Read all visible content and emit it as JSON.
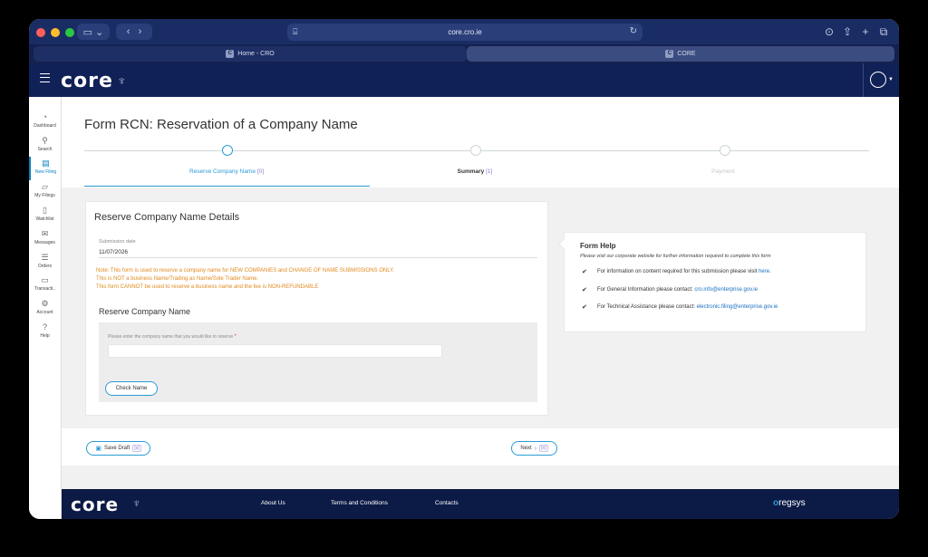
{
  "browser": {
    "url": "core.cro.ie",
    "tabs": [
      {
        "label": "Home - CRO",
        "favicon": "C"
      },
      {
        "label": "CORE",
        "favicon": "C"
      }
    ]
  },
  "app": {
    "logo": "core",
    "sidebar": [
      {
        "label": "Dashboard",
        "icon": "gauge-icon"
      },
      {
        "label": "Search",
        "icon": "search-icon"
      },
      {
        "label": "New Filing",
        "icon": "document-icon",
        "active": true
      },
      {
        "label": "My Filings",
        "icon": "folder-icon"
      },
      {
        "label": "Watchlist",
        "icon": "bookmark-icon"
      },
      {
        "label": "Messages",
        "icon": "envelope-icon"
      },
      {
        "label": "Orders",
        "icon": "list-icon"
      },
      {
        "label": "Transacti..",
        "icon": "card-icon"
      },
      {
        "label": "Account",
        "icon": "gear-icon"
      },
      {
        "label": "Help",
        "icon": "question-icon"
      }
    ]
  },
  "form": {
    "title": "Form RCN: Reservation of a Company Name",
    "steps": [
      {
        "label": "Reserve Company Name",
        "count": "[0]"
      },
      {
        "label": "Summary",
        "count": "[1]"
      },
      {
        "label": "Payment",
        "count": ""
      }
    ],
    "card_title": "Reserve Company Name Details",
    "submission_label": "Submission date",
    "submission_value": "11/07/2026",
    "notes": [
      "Note: This form is used to reserve a company name for NEW COMPANIES and CHANGE OF NAME SUBMISSIONS ONLY.",
      "This is NOT a business Name/Trading as Name/Sole Trader Name.",
      "This form CANNOT be used to reserve a business name and the fee is NON-REFUNDABLE"
    ],
    "section_title": "Reserve Company Name",
    "input_label": "Please enter the company name that you would like to reserve",
    "input_required": "*",
    "input_value": "",
    "check_button": "Check Name",
    "save_draft": "Save Draft",
    "save_draft_key": "[s]",
    "next": "Next",
    "next_key": "[n]"
  },
  "help": {
    "title": "Form Help",
    "subtitle": "Please visit our corporate website for further information required to complete this form",
    "rows": [
      {
        "text": "For information on content required for this submission please visit",
        "link": "here."
      },
      {
        "text": "For General Information please contact:",
        "link": "cro.info@enterprise.gov.ie"
      },
      {
        "text": "For Technical Assistance please contact:",
        "link": "electronic.filing@enterprise.gov.ie"
      }
    ]
  },
  "footer": {
    "logo": "core",
    "links": [
      "About Us",
      "Terms and Conditions",
      "Contacts"
    ],
    "brand_o": "o",
    "brand_rest": "regsys"
  },
  "colors": {
    "navy": "#0f2156",
    "accent": "#2a9bd6",
    "note": "#e08a1e"
  }
}
